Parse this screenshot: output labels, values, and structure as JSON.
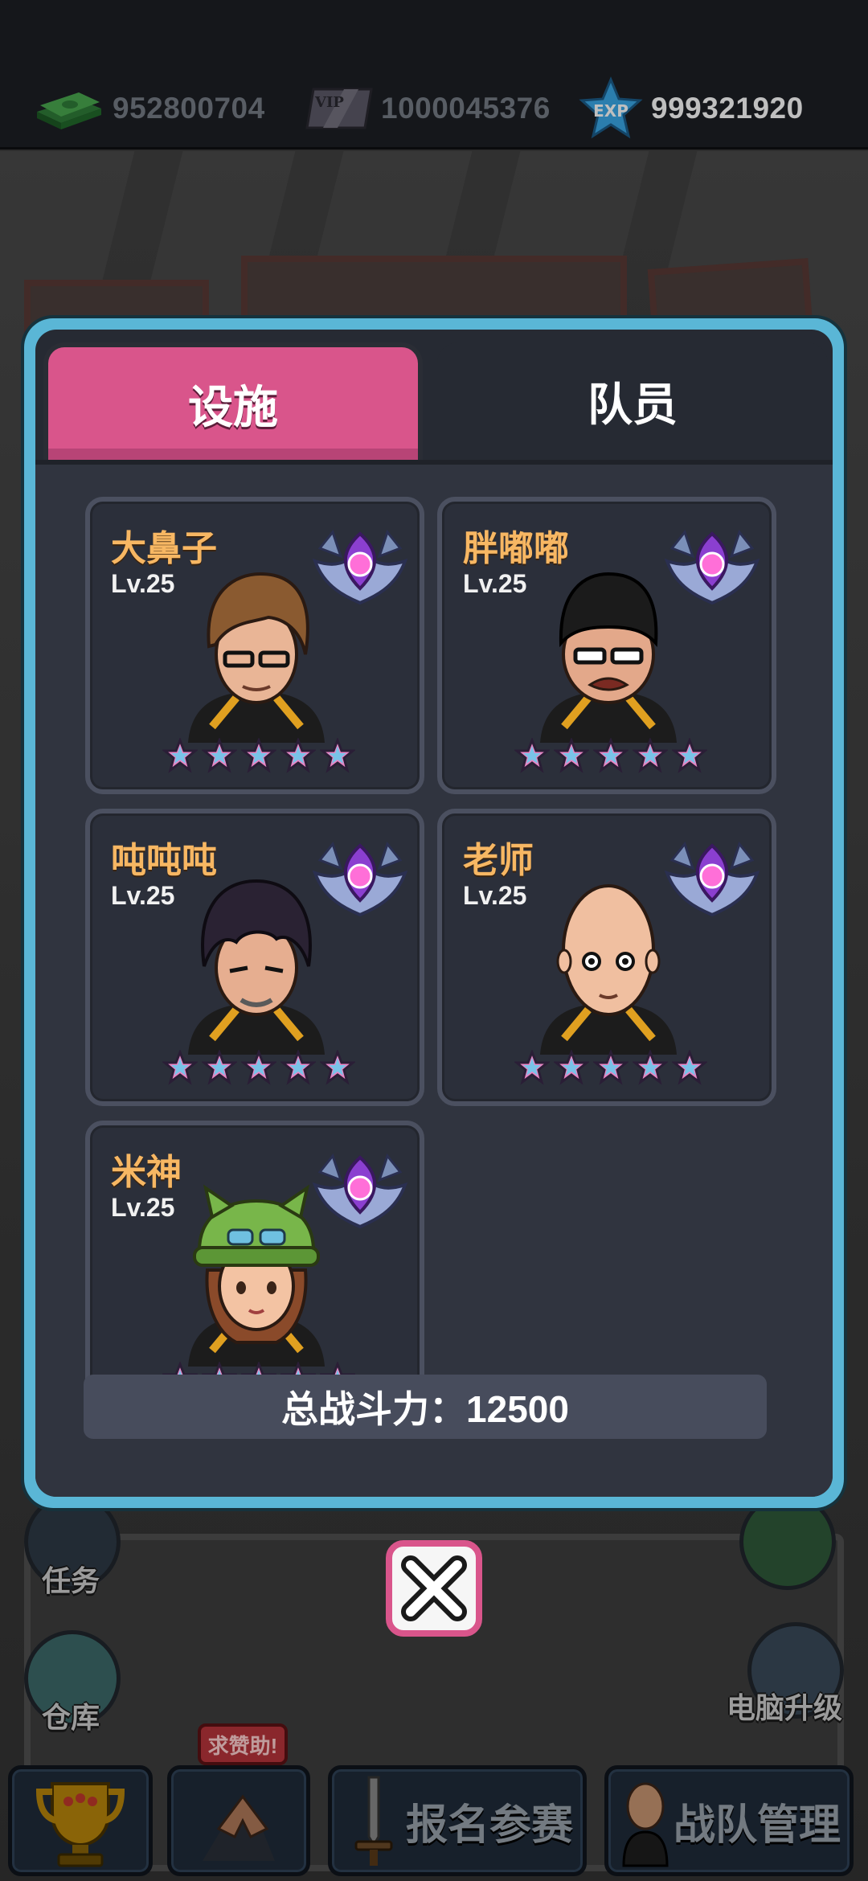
{
  "currencies": {
    "cash": {
      "icon": "cash-stack-icon",
      "value": "952800704"
    },
    "vip": {
      "icon": "vip-card-icon",
      "label": "VIP",
      "value": "1000045376"
    },
    "exp": {
      "icon": "exp-star-icon",
      "label": "EXP",
      "value": "999321920"
    }
  },
  "background": {
    "task_label": "任务",
    "warehouse_label": "仓库",
    "pc_upgrade_label": "电脑升级"
  },
  "modal": {
    "tabs": [
      {
        "label": "设施",
        "active": false
      },
      {
        "label": "队员",
        "active": true
      }
    ],
    "members": [
      {
        "name": "大鼻子",
        "level": "Lv.25",
        "stars": 5,
        "avatar": "brown-hair-glasses"
      },
      {
        "name": "胖嘟嘟",
        "level": "Lv.25",
        "stars": 5,
        "avatar": "black-cap-glasses"
      },
      {
        "name": "吨吨吨",
        "level": "Lv.25",
        "stars": 5,
        "avatar": "messy-black-hair"
      },
      {
        "name": "老师",
        "level": "Lv.25",
        "stars": 5,
        "avatar": "bald"
      },
      {
        "name": "米神",
        "level": "Lv.25",
        "stars": 5,
        "avatar": "green-cat-hat"
      }
    ],
    "total_power_label": "总战斗力：12500"
  },
  "bottom_nav": {
    "help_badge": "求赞助!",
    "register_label": "报名参赛",
    "team_manage_label": "战队管理"
  },
  "colors": {
    "modal_border": "#5ab6d6",
    "active_tab_pink": "#d9558b",
    "name_orange": "#f7b763",
    "star_pink": "#e986c4"
  }
}
